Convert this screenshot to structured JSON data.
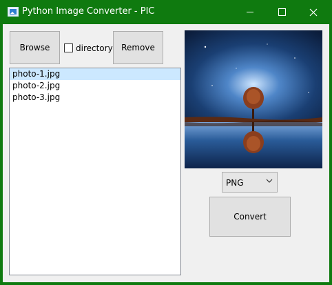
{
  "window": {
    "title": "Python Image Converter - PIC",
    "controls": [
      "minimize",
      "maximize",
      "close"
    ]
  },
  "toolbar": {
    "browse_label": "Browse",
    "directory_label": "directory",
    "directory_checked": false,
    "remove_label": "Remove"
  },
  "file_list": {
    "items": [
      "photo-1.jpg",
      "photo-2.jpg",
      "photo-3.jpg"
    ],
    "selected_index": 0
  },
  "preview": {
    "icon": "image-preview"
  },
  "format": {
    "selected": "PNG"
  },
  "convert_label": "Convert",
  "colors": {
    "titlebar": "#0f7a0f",
    "window_bg": "#f0f0f0",
    "button_bg": "#e1e1e1",
    "selection": "#cce8ff"
  }
}
